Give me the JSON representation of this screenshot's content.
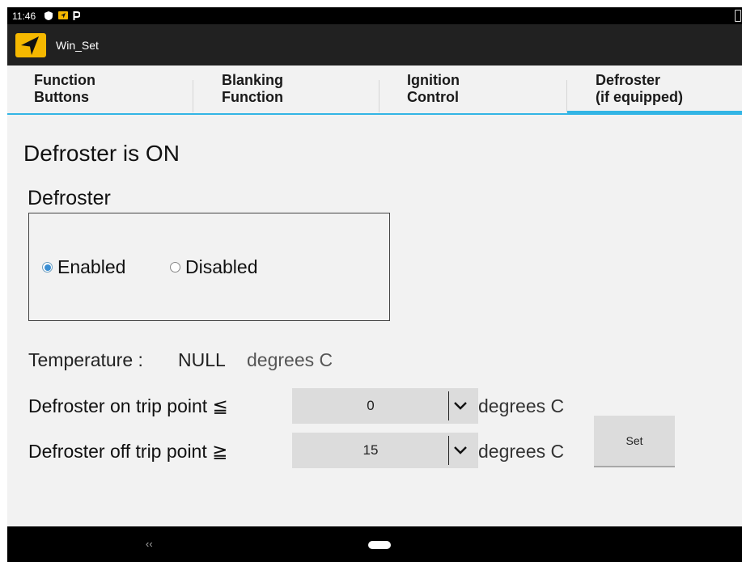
{
  "status_bar": {
    "time": "11:46"
  },
  "app": {
    "title": "Win_Set"
  },
  "tabs": [
    {
      "label": "Function\nButtons",
      "selected": false
    },
    {
      "label": "Blanking\nFunction",
      "selected": false
    },
    {
      "label": "Ignition\nControl",
      "selected": false
    },
    {
      "label": "Defroster\n(if equipped)",
      "selected": true
    }
  ],
  "main": {
    "status_heading": "Defroster is ON",
    "group_label": "Defroster",
    "radio": {
      "options": [
        {
          "label": "Enabled",
          "checked": true
        },
        {
          "label": "Disabled",
          "checked": false
        }
      ]
    },
    "temperature": {
      "label": "Temperature :",
      "value": "NULL",
      "unit": "degrees C"
    },
    "on_trip": {
      "label": "Defroster on trip point ≦",
      "value": "0",
      "unit": "degrees C"
    },
    "off_trip": {
      "label": "Defroster off trip point ≧",
      "value": "15",
      "unit": "degrees C"
    },
    "set_button": "Set"
  },
  "nav": {
    "back_label": "‹‹"
  },
  "colors": {
    "accent": "#33b5e5",
    "background": "#f2f2f2",
    "app_bar": "#212121",
    "logo": "#f5b800"
  }
}
